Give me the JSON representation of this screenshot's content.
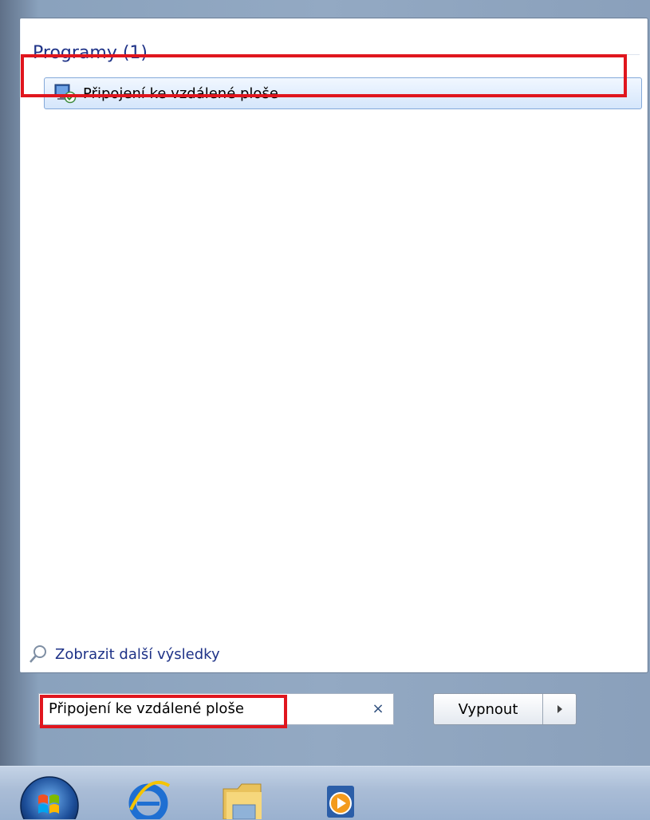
{
  "start_menu": {
    "section_title": "Programy (1)",
    "results": [
      {
        "label": "Připojení ke vzdálené ploše",
        "icon": "remote-desktop-icon"
      }
    ],
    "more_results_label": "Zobrazit další výsledky",
    "search": {
      "value": "Připojení ke vzdálené ploše",
      "clear_icon": "×"
    },
    "shutdown": {
      "label": "Vypnout",
      "arrow_icon": "chevron-right-icon"
    }
  },
  "taskbar": {
    "items": [
      {
        "name": "start-button",
        "icon": "windows-orb-icon"
      },
      {
        "name": "internet-explorer",
        "icon": "internet-explorer-icon"
      },
      {
        "name": "windows-explorer",
        "icon": "folder-icon"
      },
      {
        "name": "media-player",
        "icon": "media-player-icon"
      }
    ]
  },
  "colors": {
    "accent_blue": "#1e3287",
    "highlight_red": "#e0161e",
    "selection_bg": "#d5e6fb"
  }
}
